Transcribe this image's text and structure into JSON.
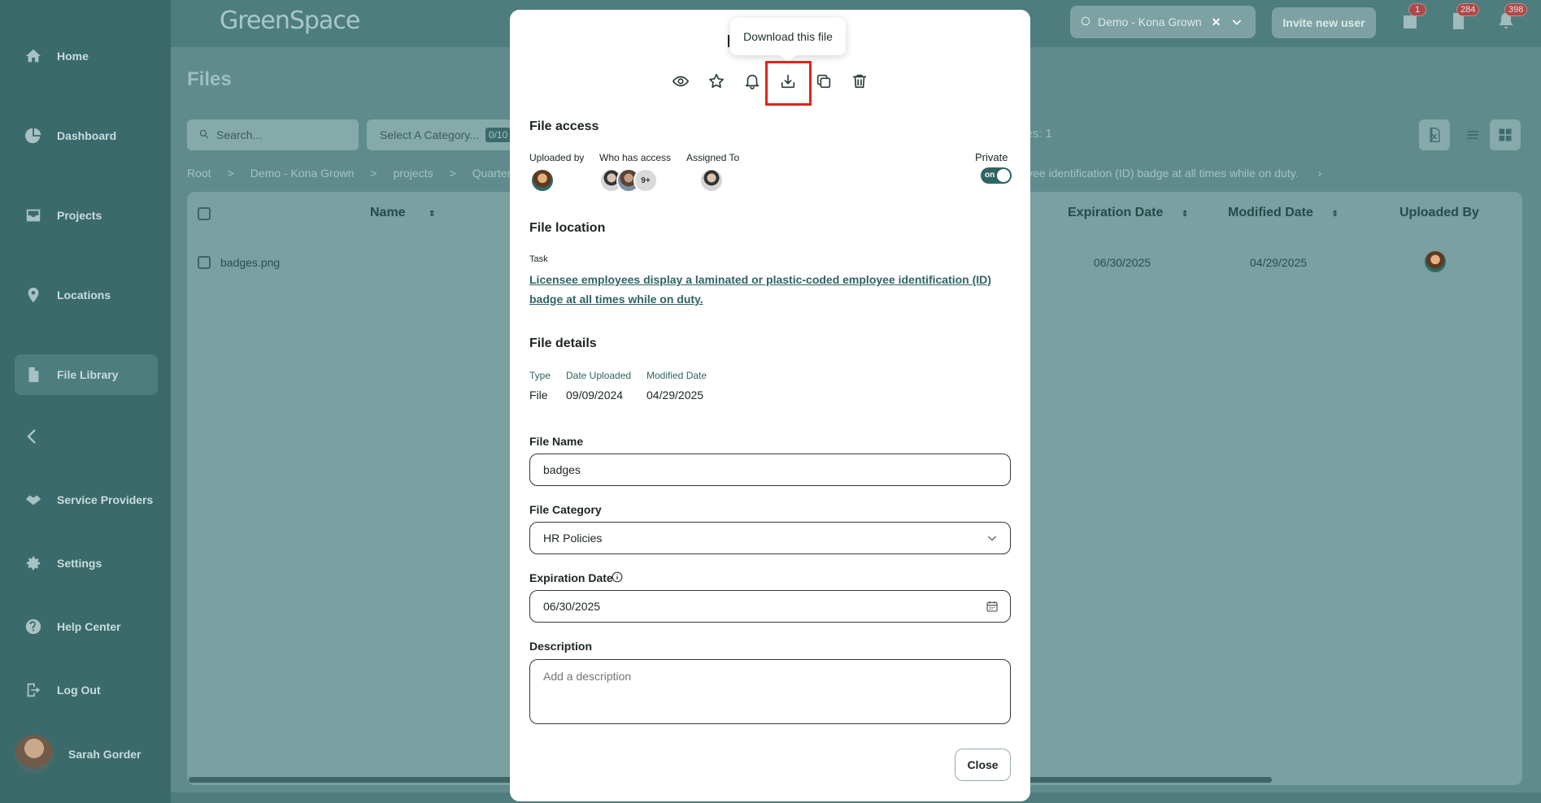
{
  "app": {
    "logo_text": "GreenSpace",
    "page_title": "Files"
  },
  "sidebar": {
    "items": [
      {
        "label": "Home",
        "icon": "home-icon"
      },
      {
        "label": "Dashboard",
        "icon": "pie-chart-icon"
      },
      {
        "label": "Projects",
        "icon": "inbox-tray-icon"
      },
      {
        "label": "Locations",
        "icon": "map-pin-icon"
      },
      {
        "label": "File Library",
        "icon": "file-icon",
        "active": true
      },
      {
        "label": "Service Providers",
        "icon": "handshake-icon"
      },
      {
        "label": "Settings",
        "icon": "gear-icon"
      },
      {
        "label": "Help Center",
        "icon": "help-circle-icon"
      },
      {
        "label": "Log Out",
        "icon": "logout-icon"
      }
    ],
    "user_name": "Sarah Gorder"
  },
  "topbar": {
    "org_name": "Demo - Kona Grown",
    "invite_label": "Invite new user",
    "badges": {
      "calendar": "1",
      "documents": "284",
      "notifications": "398"
    }
  },
  "background": {
    "search_placeholder": "Search...",
    "category_placeholder": "Select A Category...",
    "category_count": "0/10",
    "files_count_text": "les: 1",
    "breadcrumbs": [
      "Root",
      ">",
      "Demo - Kona Grown",
      ">",
      "projects",
      ">",
      "Quarterl"
    ],
    "breadcrumb_tail": "yee identification (ID) badge at all times while on duty.",
    "columns": {
      "name": "Name",
      "expiration": "Expiration Date",
      "modified": "Modified Date",
      "uploaded_by": "Uploaded By"
    },
    "row": {
      "name": "badges.png",
      "expiration": "06/30/2025",
      "modified": "04/29/2025"
    }
  },
  "modal": {
    "tooltip": "Download this file",
    "file_access": {
      "title": "File access",
      "uploaded_by_label": "Uploaded by",
      "who_has_access_label": "Who has access",
      "assigned_to_label": "Assigned To",
      "more_count": "9+",
      "private_label": "Private",
      "private_toggle": "on"
    },
    "file_location": {
      "title": "File location",
      "task_label": "Task",
      "task_link": "Licensee employees display a laminated or plastic-coded employee identification (ID) badge at all times while on duty."
    },
    "file_details": {
      "title": "File details",
      "type_label": "Type",
      "type_value": "File",
      "date_uploaded_label": "Date Uploaded",
      "date_uploaded_value": "09/09/2024",
      "modified_label": "Modified Date",
      "modified_value": "04/29/2025"
    },
    "form": {
      "file_name_label": "File Name",
      "file_name_value": "badges",
      "file_category_label": "File Category",
      "file_category_value": "HR Policies",
      "expiration_label": "Expiration Date",
      "expiration_value": "06/30/2025",
      "description_label": "Description",
      "description_placeholder": "Add a description"
    },
    "close_label": "Close"
  }
}
